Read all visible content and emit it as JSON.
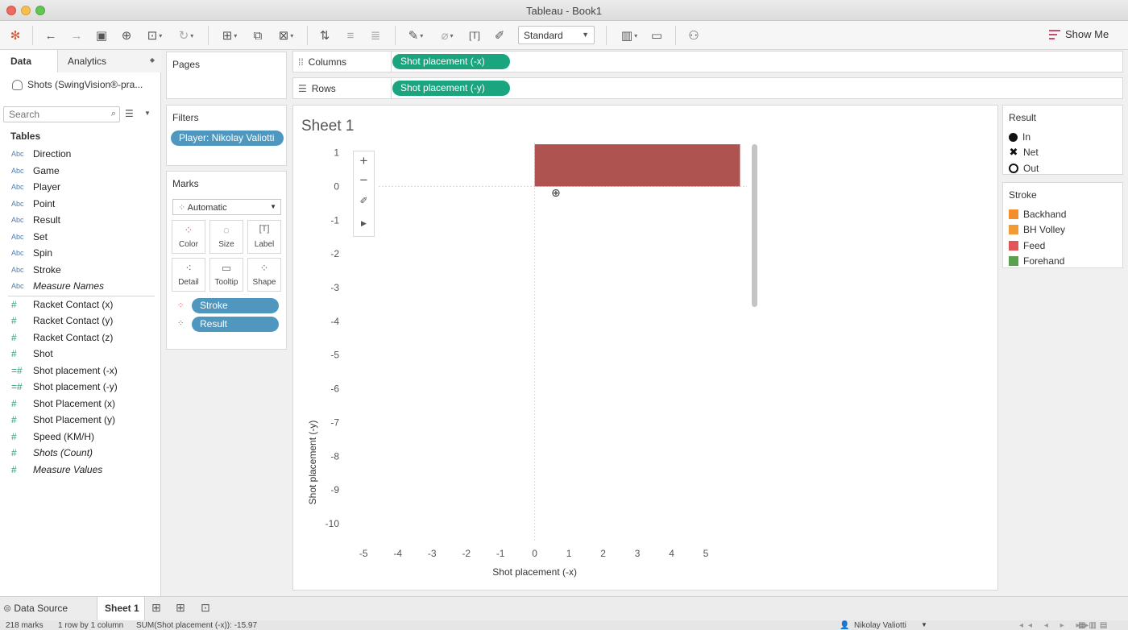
{
  "window": {
    "title": "Tableau - Book1"
  },
  "toolbar": {
    "fit_select": "Standard",
    "show_me": "Show Me",
    "icons": [
      "tableau-logo-icon",
      "back-icon",
      "forward-icon",
      "save-icon",
      "new-datasource-icon",
      "datasource-icon",
      "refresh-icon",
      "new-worksheet-icon",
      "duplicate-icon",
      "clear-icon",
      "swap-icon",
      "sort-ascending-icon",
      "sort-descending-icon",
      "highlight-icon",
      "group-icon",
      "label-icon",
      "pin-icon",
      "cards-icon",
      "presentation-icon",
      "share-icon"
    ]
  },
  "data_pane": {
    "tabs": {
      "data": "Data",
      "analytics": "Analytics"
    },
    "datasource": "Shots (SwingVision®-pra...",
    "search_placeholder": "Search",
    "tables_label": "Tables",
    "dimension_tag": "Abc",
    "dimensions": [
      {
        "label": "Direction",
        "italic": false
      },
      {
        "label": "Game",
        "italic": false
      },
      {
        "label": "Player",
        "italic": false
      },
      {
        "label": "Point",
        "italic": false
      },
      {
        "label": "Result",
        "italic": false
      },
      {
        "label": "Set",
        "italic": false
      },
      {
        "label": "Spin",
        "italic": false
      },
      {
        "label": "Stroke",
        "italic": false
      },
      {
        "label": "Measure Names",
        "italic": true
      }
    ],
    "measures": [
      {
        "label": "Racket Contact (x)",
        "italic": false
      },
      {
        "label": "Racket Contact (y)",
        "italic": false
      },
      {
        "label": "Racket Contact (z)",
        "italic": false
      },
      {
        "label": "Shot",
        "italic": false
      },
      {
        "label": "Shot placement (-x)",
        "italic": false
      },
      {
        "label": "Shot placement (-y)",
        "italic": false
      },
      {
        "label": "Shot Placement (x)",
        "italic": false
      },
      {
        "label": "Shot Placement (y)",
        "italic": false
      },
      {
        "label": "Speed (KM/H)",
        "italic": false
      },
      {
        "label": "Shots (Count)",
        "italic": true
      },
      {
        "label": "Measure Values",
        "italic": true
      }
    ]
  },
  "pages_card": {
    "title": "Pages"
  },
  "filters_card": {
    "title": "Filters",
    "filter_pill": "Player: Nikolay Valiotti"
  },
  "marks_card": {
    "title": "Marks",
    "mark_type": "Automatic",
    "buttons": {
      "color": "Color",
      "size": "Size",
      "label": "Label",
      "detail": "Detail",
      "tooltip": "Tooltip",
      "shape": "Shape"
    },
    "stroke_pill": "Stroke",
    "result_pill": "Result"
  },
  "shelves": {
    "columns_label": "Columns",
    "columns_pill": "Shot placement (-x)",
    "rows_label": "Rows",
    "rows_pill": "Shot placement (-y)"
  },
  "sheet": {
    "title": "Sheet 1"
  },
  "chart_data": {
    "type": "bar",
    "xlabel": "Shot placement (-x)",
    "ylabel": "Shot placement (-y)",
    "xlim": [
      -5.5,
      6.2
    ],
    "ylim": [
      -10.5,
      1.3
    ],
    "x_ticks": [
      -5,
      -4,
      -3,
      -2,
      -1,
      0,
      1,
      2,
      3,
      4,
      5
    ],
    "y_ticks": [
      1,
      0,
      -1,
      -2,
      -3,
      -4,
      -5,
      -6,
      -7,
      -8,
      -9,
      -10
    ],
    "bar": {
      "x0": 0,
      "x1": 6,
      "y0": 0,
      "y1": 1.25,
      "color": "#af5351"
    },
    "grid": false
  },
  "legends": {
    "result": {
      "title": "Result",
      "items": [
        {
          "label": "In",
          "shape": "filled-circle"
        },
        {
          "label": "Net",
          "shape": "x"
        },
        {
          "label": "Out",
          "shape": "open-circle"
        }
      ]
    },
    "stroke": {
      "title": "Stroke",
      "items": [
        {
          "label": "Backhand",
          "color": "#f28e2b"
        },
        {
          "label": "BH Volley",
          "color": "#f29b34"
        },
        {
          "label": "Feed",
          "color": "#e15759"
        },
        {
          "label": "Forehand",
          "color": "#59a14f"
        }
      ]
    }
  },
  "bottom_tabs": {
    "data_source": "Data Source",
    "sheet1": "Sheet 1"
  },
  "status": {
    "marks": "218 marks",
    "dims": "1 row by 1 column",
    "sum": "SUM(Shot placement (-x)): -15.97",
    "user": "Nikolay Valiotti"
  }
}
